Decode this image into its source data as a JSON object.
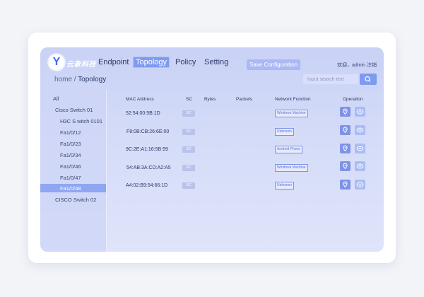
{
  "header": {
    "logo_letter": "Y",
    "logo_text": "云象科技",
    "nav": [
      "Endpoint",
      "Topology",
      "Policy",
      "Setting"
    ],
    "active_nav": "Topology",
    "save_label": "Save Configuration",
    "user_text": "欢迎，admin  注销"
  },
  "breadcrumb": {
    "home": "home",
    "sep": " / ",
    "current": "Topology"
  },
  "search": {
    "placeholder": "Input search text"
  },
  "tree": {
    "items": [
      "All",
      "Cisco Switch 01",
      "H3C S witch 0101",
      "Fa1/0/12",
      "Fa1/0/23",
      "Fa1/0/34",
      "Fa1/0/46",
      "Fa1/0/47",
      "Fa1/0/48",
      "CISCO Switch 02"
    ],
    "selected": "Fa1/0/48"
  },
  "table": {
    "headers": [
      "MAC Address",
      "SC",
      "Bytes",
      "Packets",
      "Network Function",
      "Operation"
    ],
    "rows": [
      {
        "mac": "52:54:00:5B:1D",
        "sc": "SC",
        "bytes": "",
        "packets": "",
        "function": "Windows Machine"
      },
      {
        "mac": "F8:0B:CB:26:6E:00",
        "sc": "SC",
        "bytes": "",
        "packets": "",
        "function": "Unknown"
      },
      {
        "mac": "9C:2E:A1:16:5B:99",
        "sc": "SC",
        "bytes": "",
        "packets": "",
        "function": "Android Phone"
      },
      {
        "mac": "54:AB:3A:CD:A2:A5",
        "sc": "SC",
        "bytes": "",
        "packets": "",
        "function": "Windows Machine"
      },
      {
        "mac": "A4:02:B9:54:66:1D",
        "sc": "SC",
        "bytes": "",
        "packets": "",
        "function": "Unknown"
      }
    ],
    "operations": [
      "location-icon",
      "eye-icon"
    ]
  },
  "colors": {
    "accent": "#7f9bf0",
    "panel": "#c9d2f6",
    "tag_border": "#7d92e6"
  }
}
